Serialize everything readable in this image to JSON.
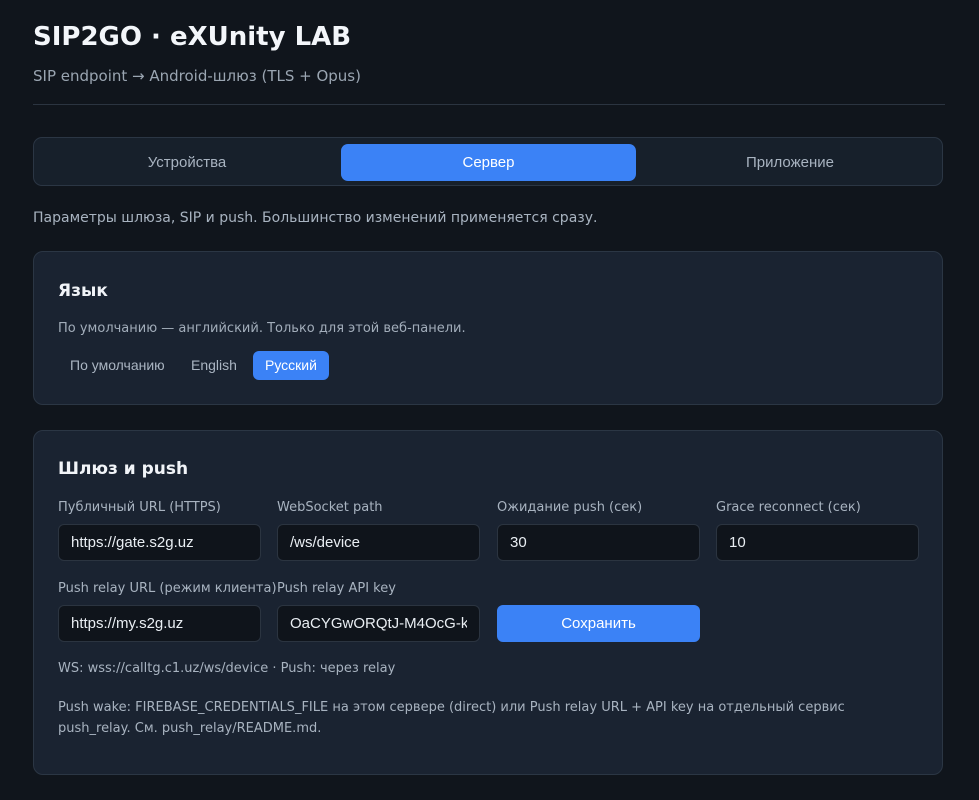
{
  "header": {
    "title": "SIP2GO · eXUnity LAB",
    "subtitle": "SIP endpoint → Android-шлюз (TLS + Opus)"
  },
  "tabs": [
    {
      "label": "Устройства",
      "active": false
    },
    {
      "label": "Сервер",
      "active": true
    },
    {
      "label": "Приложение",
      "active": false
    }
  ],
  "description": "Параметры шлюза, SIP и push. Большинство изменений применяется сразу.",
  "language": {
    "title": "Язык",
    "hint": "По умолчанию — английский. Только для этой веб-панели.",
    "options": [
      "По умолчанию",
      "English",
      "Русский"
    ],
    "selected": "Русский"
  },
  "gateway": {
    "title": "Шлюз и push",
    "fields": {
      "public_url": {
        "label": "Публичный URL (HTTPS)",
        "value": "https://gate.s2g.uz"
      },
      "ws_path": {
        "label": "WebSocket path",
        "value": "/ws/device"
      },
      "push_wait": {
        "label": "Ожидание push (сек)",
        "value": "30"
      },
      "grace_reconnect": {
        "label": "Grace reconnect (сек)",
        "value": "10"
      },
      "push_relay_url": {
        "label": "Push relay URL (режим клиента)",
        "value": "https://my.s2g.uz"
      },
      "push_relay_key": {
        "label": "Push relay API key",
        "value": "OaCYGwORQtJ-M4OcG-k"
      }
    },
    "save_label": "Сохранить",
    "status": "WS: wss://calltg.c1.uz/ws/device · Push: через relay",
    "note": "Push wake: FIREBASE_CREDENTIALS_FILE на этом сервере (direct) или Push relay URL + API key на отдельный сервис push_relay. См. push_relay/README.md."
  },
  "colors": {
    "accent": "#3b82f6",
    "background": "#10151c",
    "card": "#1a2331"
  }
}
